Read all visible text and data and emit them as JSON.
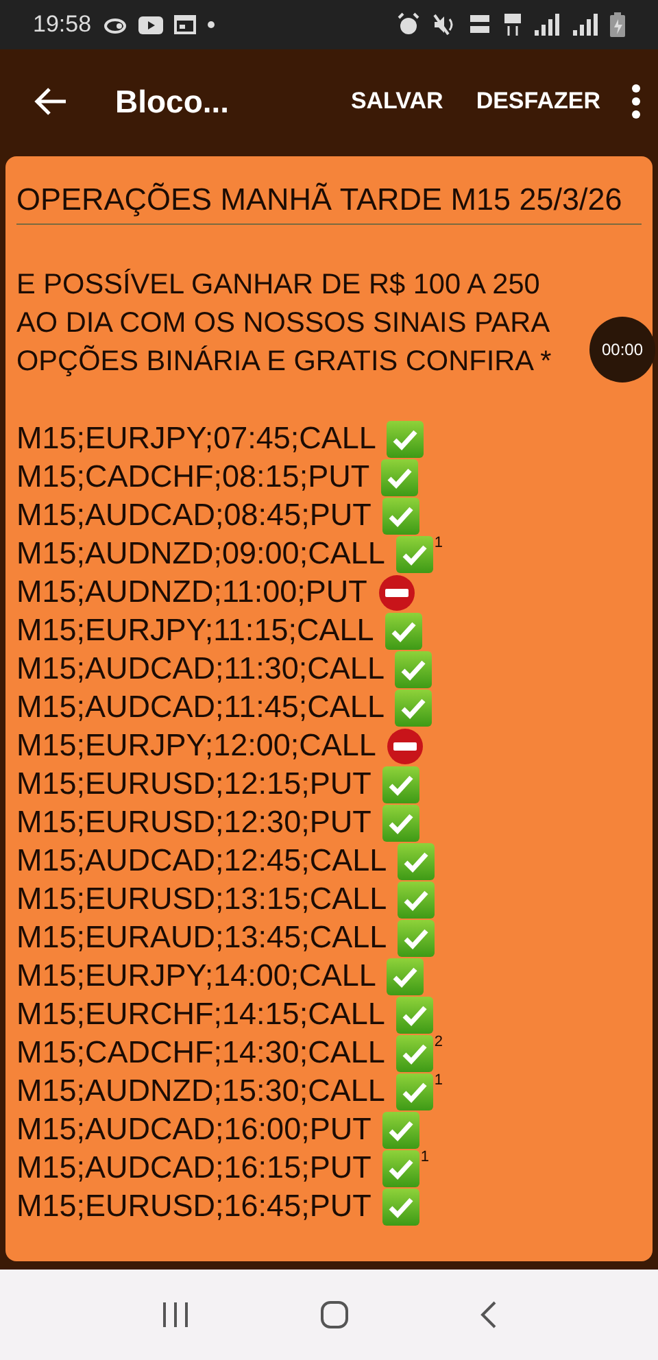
{
  "status_bar": {
    "time": "19:58"
  },
  "toolbar": {
    "title": "Bloco...",
    "actions": [
      "SALVAR",
      "DESFAZER"
    ]
  },
  "note": {
    "title": "OPERAÇÕES MANHÃ TARDE M15 25/3/26",
    "intro": "E POSSÍVEL GANHAR DE R$ 100 A 250 AO DIA COM OS NOSSOS SINAIS PARA OPÇÕES BINÁRIA E GRATIS CONFIRA *",
    "signals": [
      {
        "text": "M15;EURJPY;07:45;CALL",
        "kind": "win"
      },
      {
        "text": "M15;CADCHF;08:15;PUT",
        "kind": "win"
      },
      {
        "text": "M15;AUDCAD;08:45;PUT",
        "kind": "win"
      },
      {
        "text": "M15;AUDNZD;09:00;CALL",
        "kind": "win",
        "gale": "1"
      },
      {
        "text": "M15;AUDNZD;11:00;PUT",
        "kind": "loss"
      },
      {
        "text": "M15;EURJPY;11:15;CALL",
        "kind": "win"
      },
      {
        "text": "M15;AUDCAD;11:30;CALL",
        "kind": "win"
      },
      {
        "text": "M15;AUDCAD;11:45;CALL",
        "kind": "win"
      },
      {
        "text": "M15;EURJPY;12:00;CALL",
        "kind": "loss"
      },
      {
        "text": "M15;EURUSD;12:15;PUT",
        "kind": "win"
      },
      {
        "text": "M15;EURUSD;12:30;PUT",
        "kind": "win"
      },
      {
        "text": "M15;AUDCAD;12:45;CALL",
        "kind": "win"
      },
      {
        "text": "M15;EURUSD;13:15;CALL",
        "kind": "win"
      },
      {
        "text": "M15;EURAUD;13:45;CALL",
        "kind": "win"
      },
      {
        "text": "M15;EURJPY;14:00;CALL",
        "kind": "win"
      },
      {
        "text": "M15;EURCHF;14:15;CALL",
        "kind": "win"
      },
      {
        "text": "M15;CADCHF;14:30;CALL",
        "kind": "win",
        "gale": "2"
      },
      {
        "text": "M15;AUDNZD;15:30;CALL",
        "kind": "win",
        "gale": "1"
      },
      {
        "text": "M15;AUDCAD;16:00;PUT",
        "kind": "win"
      },
      {
        "text": "M15;AUDCAD;16:15;PUT",
        "kind": "win",
        "gale": "1"
      },
      {
        "text": "M15;EURUSD;16:45;PUT",
        "kind": "win"
      }
    ]
  },
  "timer": {
    "text": "00:00"
  }
}
